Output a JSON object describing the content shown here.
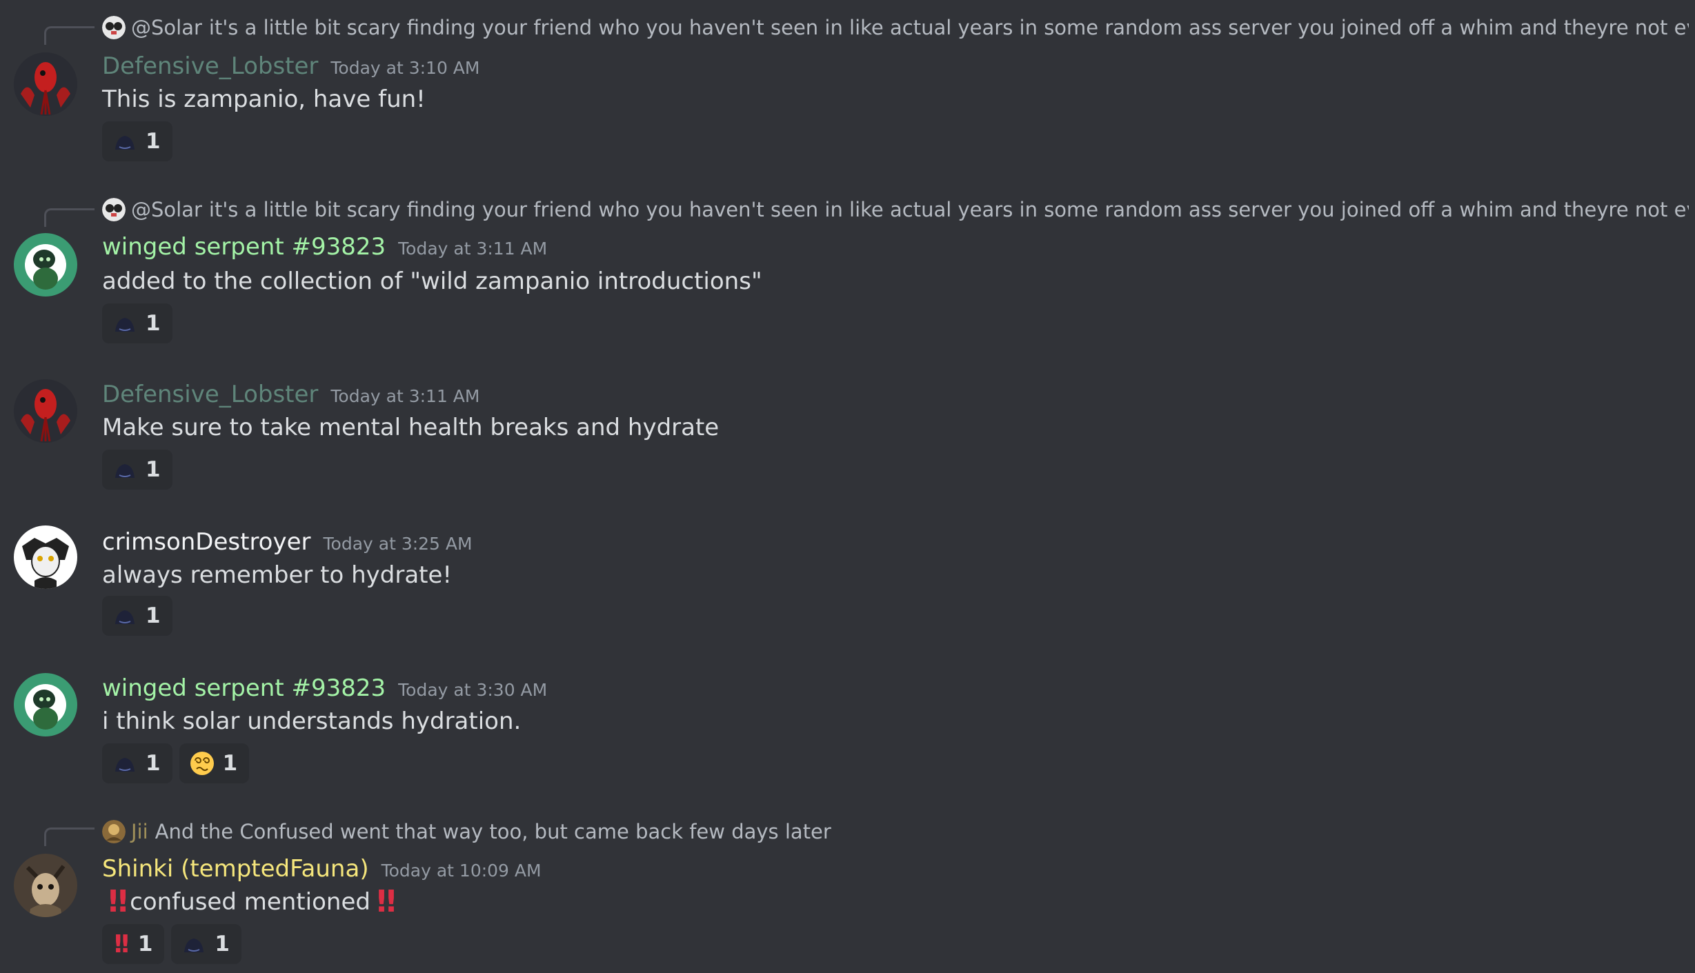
{
  "colors": {
    "background": "#313338",
    "defensive_lobster_name": "#5f857a",
    "winged_serpent_name": "#a4f3a7",
    "crimson_name": "#f2f3f5",
    "shinki_name": "#f5e67c",
    "timestamp": "#949ba4"
  },
  "messages": [
    {
      "reply": {
        "author": "@Solar",
        "text": "it's a little bit scary finding your friend who you haven't seen in like actual years in some random ass server you joined off a whim and theyre not even speaking ful"
      },
      "author": "Defensive_Lobster",
      "timestamp": "Today at 3:10 AM",
      "text": "This is zampanio, have fun!",
      "reactions": [
        {
          "emoji": "dark-hat-emoji",
          "count": "1"
        }
      ]
    },
    {
      "reply": {
        "author": "@Solar",
        "text": "it's a little bit scary finding your friend who you haven't seen in like actual years in some random ass server you joined off a whim and theyre not even speaking ful"
      },
      "author": "winged serpent #93823",
      "timestamp": "Today at 3:11 AM",
      "text": "added to the collection of \"wild zampanio introductions\"",
      "reactions": [
        {
          "emoji": "dark-hat-emoji",
          "count": "1"
        }
      ]
    },
    {
      "author": "Defensive_Lobster",
      "timestamp": "Today at 3:11 AM",
      "text": "Make sure to take mental health breaks and hydrate",
      "reactions": [
        {
          "emoji": "dark-hat-emoji",
          "count": "1"
        }
      ]
    },
    {
      "author": "crimsonDestroyer",
      "timestamp": "Today at 3:25 AM",
      "text": "always remember to hydrate!",
      "reactions": [
        {
          "emoji": "dark-hat-emoji",
          "count": "1"
        }
      ]
    },
    {
      "author": "winged serpent #93823",
      "timestamp": "Today at 3:30 AM",
      "text": "i think solar understands hydration.",
      "reactions": [
        {
          "emoji": "dark-hat-emoji",
          "count": "1"
        },
        {
          "emoji": "dizzy-face-emoji",
          "count": "1"
        }
      ]
    },
    {
      "reply": {
        "author": "Jii",
        "text": "And the Confused went that way too, but came back few days later"
      },
      "author": "Shinki (temptedFauna)",
      "timestamp": "Today at 10:09 AM",
      "text": "confused mentioned",
      "reactions": [
        {
          "emoji": "double-exclamation-emoji",
          "count": "1"
        },
        {
          "emoji": "dark-hat-emoji",
          "count": "1"
        }
      ]
    }
  ]
}
